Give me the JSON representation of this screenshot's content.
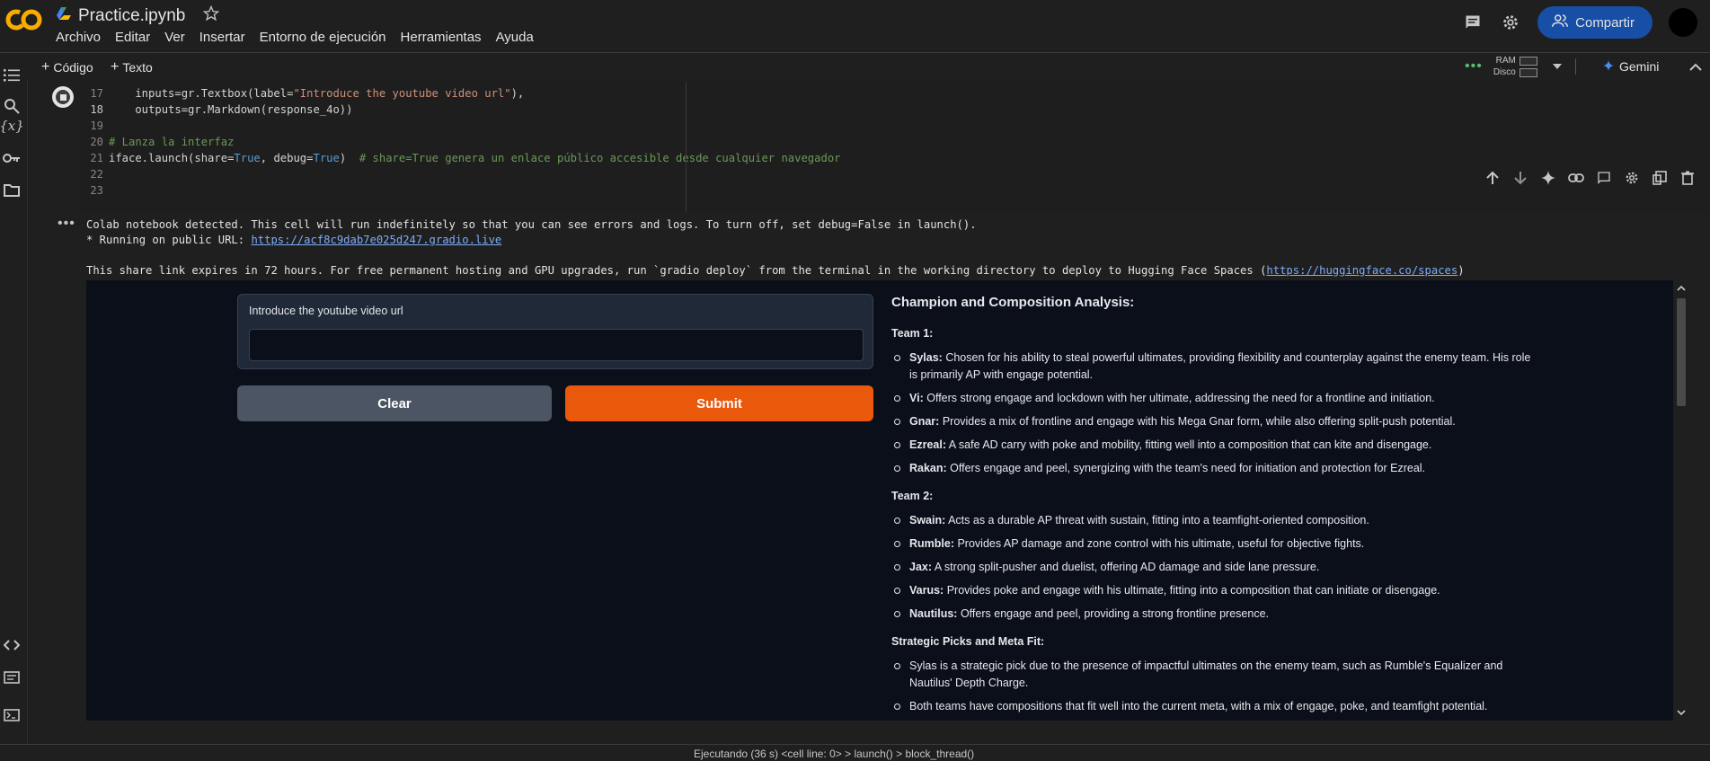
{
  "app": {
    "logo": "CO",
    "title": "Practice.ipynb",
    "menu": [
      "Archivo",
      "Editar",
      "Ver",
      "Insertar",
      "Entorno de ejecución",
      "Herramientas",
      "Ayuda"
    ],
    "share_label": "Compartir"
  },
  "toolbar": {
    "add_code": "Código",
    "add_text": "Texto",
    "ram_label": "RAM",
    "disk_label": "Disco",
    "gemini_label": "Gemini"
  },
  "code": {
    "lines": [
      {
        "num": "17",
        "text": "    inputs=gr.Textbox(label=\"Introduce the youtube video url\"),"
      },
      {
        "num": "18",
        "text": "    outputs=gr.Markdown(response_4o))"
      },
      {
        "num": "19",
        "text": ""
      },
      {
        "num": "20",
        "text": "# Lanza la interfaz"
      },
      {
        "num": "21",
        "text": "iface.launch(share=True, debug=True)  # share=True genera un enlace público accesible desde cualquier navegador"
      },
      {
        "num": "22",
        "text": ""
      },
      {
        "num": "23",
        "text": ""
      }
    ]
  },
  "output": {
    "line1": "Colab notebook detected. This cell will run indefinitely so that you can see errors and logs. To turn off, set debug=False in launch().",
    "line2_prefix": "* Running on public URL: ",
    "line2_link": "https://acf8c9dab7e025d247.gradio.live",
    "line3_prefix": "This share link expires in 72 hours. For free permanent hosting and GPU upgrades, run `gradio deploy` from the terminal in the working directory to deploy to Hugging Face Spaces (",
    "line3_link": "https://huggingface.co/spaces",
    "line3_suffix": ")"
  },
  "gradio": {
    "input_label": "Introduce the youtube video url",
    "input_value": "",
    "clear_label": "Clear",
    "submit_label": "Submit",
    "md_title": "Champion and Composition Analysis:",
    "team1_title": "Team 1:",
    "team1": [
      {
        "name": "Sylas:",
        "text": " Chosen for his ability to steal powerful ultimates, providing flexibility and counterplay against the enemy team. His role is primarily AP with engage potential."
      },
      {
        "name": "Vi:",
        "text": " Offers strong engage and lockdown with her ultimate, addressing the need for a frontline and initiation."
      },
      {
        "name": "Gnar:",
        "text": " Provides a mix of frontline and engage with his Mega Gnar form, while also offering split-push potential."
      },
      {
        "name": "Ezreal:",
        "text": " A safe AD carry with poke and mobility, fitting well into a composition that can kite and disengage."
      },
      {
        "name": "Rakan:",
        "text": " Offers engage and peel, synergizing with the team's need for initiation and protection for Ezreal."
      }
    ],
    "team2_title": "Team 2:",
    "team2": [
      {
        "name": "Swain:",
        "text": " Acts as a durable AP threat with sustain, fitting into a teamfight-oriented composition."
      },
      {
        "name": "Rumble:",
        "text": " Provides AP damage and zone control with his ultimate, useful for objective fights."
      },
      {
        "name": "Jax:",
        "text": " A strong split-pusher and duelist, offering AD damage and side lane pressure."
      },
      {
        "name": "Varus:",
        "text": " Provides poke and engage with his ultimate, fitting into a composition that can initiate or disengage."
      },
      {
        "name": "Nautilus:",
        "text": " Offers engage and peel, providing a strong frontline presence."
      }
    ],
    "strategic_title": "Strategic Picks and Meta Fit:",
    "strategic": [
      {
        "text": "Sylas is a strategic pick due to the presence of impactful ultimates on the enemy team, such as Rumble's Equalizer and Nautilus' Depth Charge."
      },
      {
        "text": "Both teams have compositions that fit well into the current meta, with a mix of engage, poke, and teamfight potential."
      }
    ]
  },
  "status": {
    "text": "Ejecutando (36 s)  <cell line: 0> > launch() > block_thread()"
  },
  "colors": {
    "accent_submit": "#ea580c",
    "share_button": "#174ea6"
  }
}
